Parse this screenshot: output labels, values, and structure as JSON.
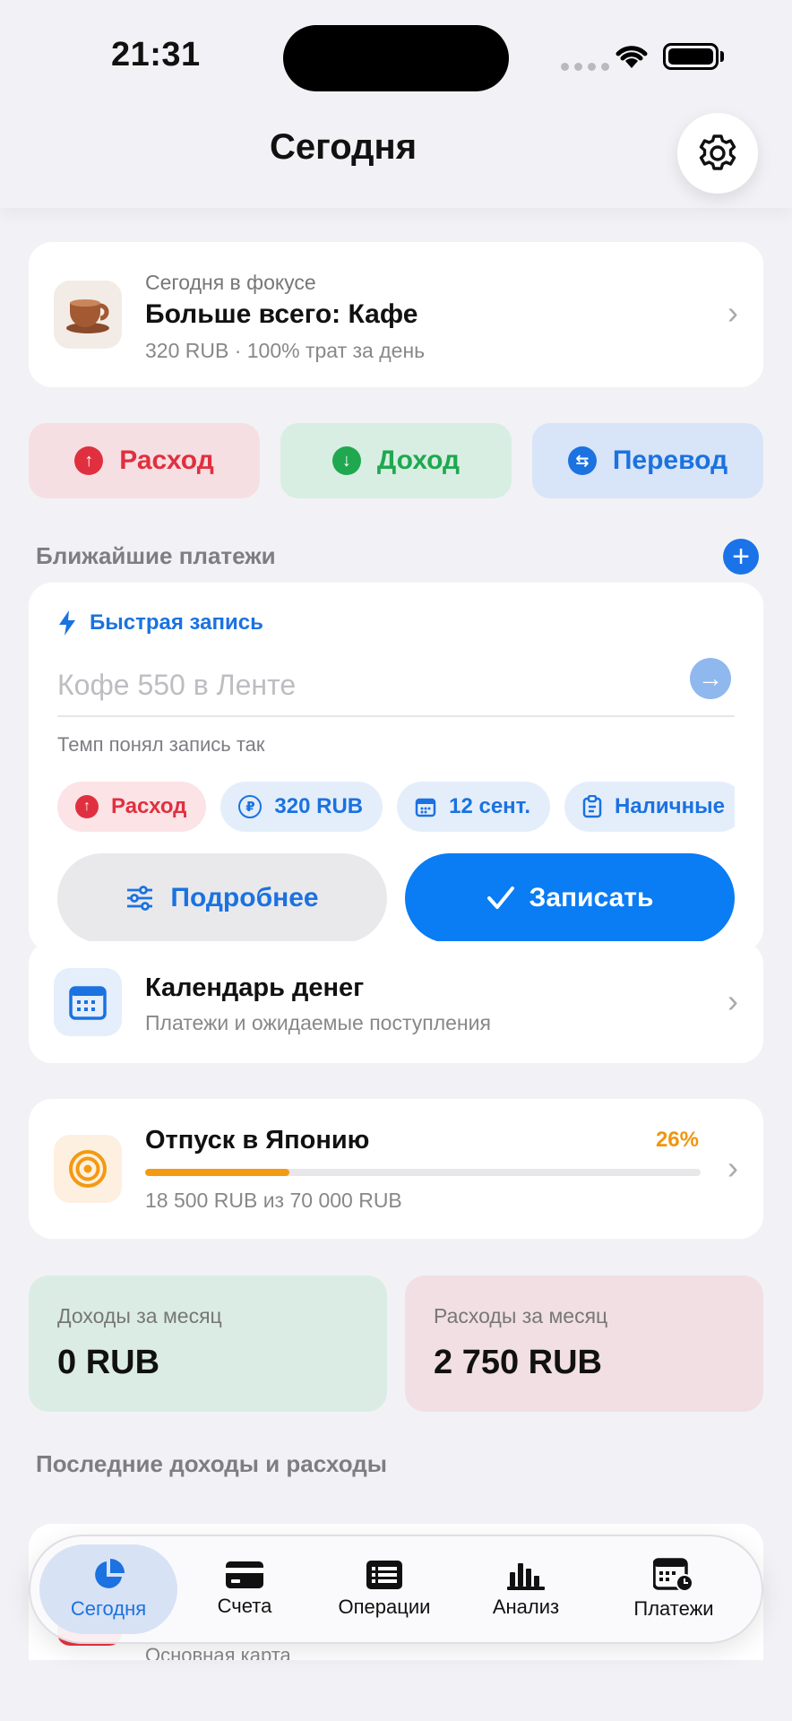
{
  "status_bar": {
    "time": "21:31"
  },
  "header": {
    "title": "Сегодня"
  },
  "focus": {
    "eyebrow": "Сегодня в фокусе",
    "title": "Больше всего: Кафе",
    "subtitle": "320 RUB · 100% трат за день",
    "icon": "coffee-cup-icon"
  },
  "actions": {
    "expense": "Расход",
    "income": "Доход",
    "transfer": "Перевод"
  },
  "upcoming": {
    "label": "Ближайшие платежи"
  },
  "quick_entry": {
    "title": "Быстрая запись",
    "placeholder": "Кофе 550 в Ленте",
    "value": "",
    "parsed_label": "Темп понял запись так",
    "chips": {
      "type": "Расход",
      "amount": "320 RUB",
      "date": "12 сент.",
      "account": "Наличные"
    },
    "more_label": "Подробнее",
    "save_label": "Записать"
  },
  "calendar": {
    "title": "Календарь денег",
    "subtitle": "Платежи и ожидаемые поступления"
  },
  "goal": {
    "title": "Отпуск в Японию",
    "percent_label": "26%",
    "progress": 0.26,
    "subtitle": "18 500 RUB из 70 000 RUB"
  },
  "summary": {
    "income_label": "Доходы за месяц",
    "income_value": "0 RUB",
    "expense_label": "Расходы за месяц",
    "expense_value": "2 750 RUB"
  },
  "recent": {
    "label": "Последние доходы и расходы",
    "peek_subtitle": "Основная карта"
  },
  "tabbar": {
    "today": "Сегодня",
    "accounts": "Счета",
    "operations": "Операции",
    "analysis": "Анализ",
    "payments": "Платежи",
    "active": "today"
  },
  "colors": {
    "accent": "#0a7cf4",
    "expense": "#e0303f",
    "income": "#1fa84f",
    "goal": "#f39a12"
  }
}
